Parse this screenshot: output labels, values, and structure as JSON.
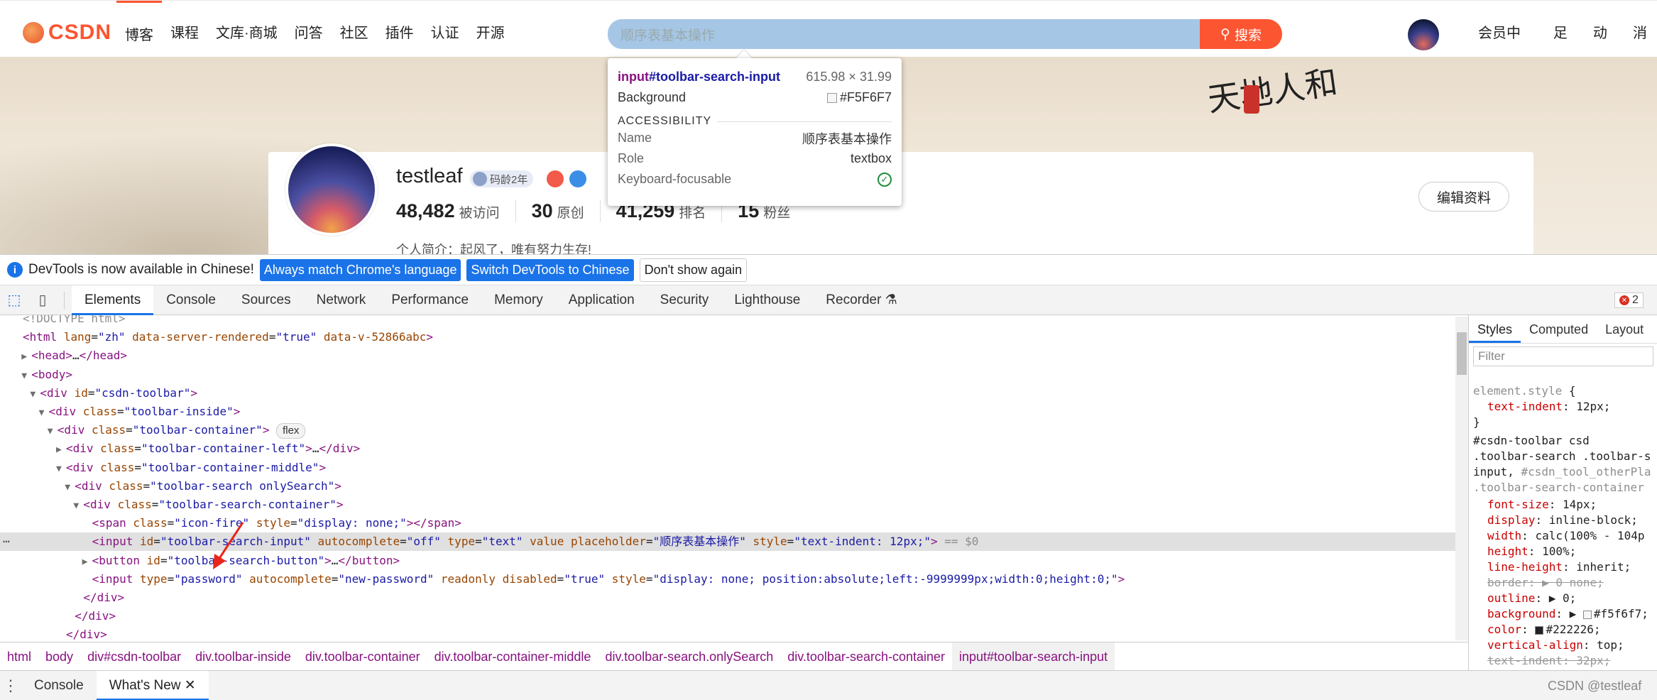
{
  "site": {
    "logo_text": "CSDN",
    "nav": [
      "博客",
      "课程",
      "文库·商城",
      "问答",
      "社区",
      "插件",
      "认证",
      "开源"
    ],
    "search_placeholder": "顺序表基本操作",
    "search_button": "搜索",
    "right_nav": [
      "会员中心 🎁",
      "足迹",
      "动态",
      "消"
    ],
    "accent": "#fc5531"
  },
  "profile": {
    "username": "testleaf",
    "badge_age": "码龄2年",
    "stats": [
      {
        "value": "48,482",
        "label": "被访问"
      },
      {
        "value": "30",
        "label": "原创"
      },
      {
        "value": "41,259",
        "label": "排名"
      },
      {
        "value": "15",
        "label": "粉丝"
      }
    ],
    "bio": "个人简介：起风了，唯有努力生存!",
    "edit_button": "编辑资料",
    "calligraphy": "天地人和"
  },
  "tooltip": {
    "selector_tag": "input",
    "selector_id": "#toolbar-search-input",
    "size": "615.98 × 31.99",
    "background_label": "Background",
    "background_value": "#F5F6F7",
    "section": "ACCESSIBILITY",
    "name_label": "Name",
    "name_value": "顺序表基本操作",
    "role_label": "Role",
    "role_value": "textbox",
    "focus_label": "Keyboard-focusable"
  },
  "infobar": {
    "message": "DevTools is now available in Chinese!",
    "btn_match": "Always match Chrome's language",
    "btn_switch": "Switch DevTools to Chinese",
    "btn_dismiss": "Don't show again"
  },
  "devtools_tabs": [
    "Elements",
    "Console",
    "Sources",
    "Network",
    "Performance",
    "Memory",
    "Application",
    "Security",
    "Lighthouse",
    "Recorder ⚗"
  ],
  "error_count": "2",
  "dom_lines": [
    {
      "indent": 0,
      "tri": "",
      "html": "<span class=\"cm\">&lt;!DOCTYPE html&gt;</span>"
    },
    {
      "indent": 0,
      "tri": "",
      "html": "<span class=\"tg\">&lt;html</span> <span class=\"an\">lang</span>=<span class=\"av\">\"zh\"</span> <span class=\"an\">data-server-rendered</span>=<span class=\"av\">\"true\"</span> <span class=\"an\">data-v-52866abc</span><span class=\"tg\">&gt;</span>"
    },
    {
      "indent": 1,
      "tri": "▶",
      "html": "<span class=\"tg\">&lt;head&gt;</span>…<span class=\"tg\">&lt;/head&gt;</span>"
    },
    {
      "indent": 1,
      "tri": "▼",
      "html": "<span class=\"tg\">&lt;body&gt;</span>"
    },
    {
      "indent": 2,
      "tri": "▼",
      "html": "<span class=\"tg\">&lt;div</span> <span class=\"an\">id</span>=<span class=\"av\">\"csdn-toolbar\"</span><span class=\"tg\">&gt;</span>"
    },
    {
      "indent": 3,
      "tri": "▼",
      "html": "<span class=\"tg\">&lt;div</span> <span class=\"an\">class</span>=<span class=\"av\">\"toolbar-inside\"</span><span class=\"tg\">&gt;</span>"
    },
    {
      "indent": 4,
      "tri": "▼",
      "html": "<span class=\"tg\">&lt;div</span> <span class=\"an\">class</span>=<span class=\"av\">\"toolbar-container\"</span><span class=\"tg\">&gt;</span> <span class=\"pill\">flex</span>"
    },
    {
      "indent": 5,
      "tri": "▶",
      "html": "<span class=\"tg\">&lt;div</span> <span class=\"an\">class</span>=<span class=\"av\">\"toolbar-container-left\"</span><span class=\"tg\">&gt;</span>…<span class=\"tg\">&lt;/div&gt;</span>"
    },
    {
      "indent": 5,
      "tri": "▼",
      "html": "<span class=\"tg\">&lt;div</span> <span class=\"an\">class</span>=<span class=\"av\">\"toolbar-container-middle\"</span><span class=\"tg\">&gt;</span>"
    },
    {
      "indent": 6,
      "tri": "▼",
      "html": "<span class=\"tg\">&lt;div</span> <span class=\"an\">class</span>=<span class=\"av\">\"toolbar-search onlySearch\"</span><span class=\"tg\">&gt;</span>"
    },
    {
      "indent": 7,
      "tri": "▼",
      "html": "<span class=\"tg\">&lt;div</span> <span class=\"an\">class</span>=<span class=\"av\">\"toolbar-search-container\"</span><span class=\"tg\">&gt;</span>"
    },
    {
      "indent": 8,
      "tri": "",
      "html": "<span class=\"tg\">&lt;span</span> <span class=\"an\">class</span>=<span class=\"av\">\"icon-fire\"</span> <span class=\"an\">style</span>=<span class=\"av\">\"display: none;\"</span><span class=\"tg\">&gt;&lt;/span&gt;</span>"
    },
    {
      "indent": 8,
      "tri": "",
      "hl": true,
      "html": "<span class=\"tg\">&lt;input</span> <span class=\"an\">id</span>=<span class=\"av\">\"toolbar-search-input\"</span> <span class=\"an\">autocomplete</span>=<span class=\"av\">\"off\"</span> <span class=\"an\">type</span>=<span class=\"av\">\"text\"</span> <span class=\"an\">value</span> <span class=\"an\">placeholder</span>=<span class=\"av\">\"顺序表基本操作\"</span> <span class=\"an\">style</span>=<span class=\"av\">\"text-indent: 12px;\"</span><span class=\"tg\">&gt;</span> <span class=\"cm\">== $0</span>"
    },
    {
      "indent": 8,
      "tri": "▶",
      "html": "<span class=\"tg\">&lt;button</span> <span class=\"an\">id</span>=<span class=\"av\">\"toolbar-search-button\"</span><span class=\"tg\">&gt;</span>…<span class=\"tg\">&lt;/button&gt;</span>"
    },
    {
      "indent": 8,
      "tri": "",
      "html": "<span class=\"tg\">&lt;input</span> <span class=\"an\">type</span>=<span class=\"av\">\"password\"</span> <span class=\"an\">autocomplete</span>=<span class=\"av\">\"new-password\"</span> <span class=\"an\">readonly</span> <span class=\"an\">disabled</span>=<span class=\"av\">\"true\"</span> <span class=\"an\">style</span>=<span class=\"av\">\"display: none; position:absolute;left:-9999999px;width:0;height:0;\"</span><span class=\"tg\">&gt;</span>"
    },
    {
      "indent": 7,
      "tri": "",
      "html": "<span class=\"tg\">&lt;/div&gt;</span>"
    },
    {
      "indent": 6,
      "tri": "",
      "html": "<span class=\"tg\">&lt;/div&gt;</span>"
    },
    {
      "indent": 5,
      "tri": "",
      "html": "<span class=\"tg\">&lt;/div&gt;</span>"
    }
  ],
  "breadcrumbs": [
    "html",
    "body",
    "div#csdn-toolbar",
    "div.toolbar-inside",
    "div.toolbar-container",
    "div.toolbar-container-middle",
    "div.toolbar-search.onlySearch",
    "div.toolbar-search-container",
    "input#toolbar-search-input"
  ],
  "styles_tabs": [
    "Styles",
    "Computed",
    "Layout"
  ],
  "styles_filter": "Filter",
  "style_lines": [
    {
      "cls": "sl",
      "html": "<span class=\"cm\">element.style</span> {"
    },
    {
      "cls": "sl ind",
      "html": "<span class=\"pn\">text-indent</span>: <span class=\"pv\">12px;</span>"
    },
    {
      "cls": "sl",
      "html": "}"
    },
    {
      "cls": "sl",
      "html": "#csdn-toolbar          csd"
    },
    {
      "cls": "sl",
      "html": ".toolbar-search .toolbar-s"
    },
    {
      "cls": "sl",
      "html": "input, <span class=\"cm\">#csdn_tool_otherPla</span>"
    },
    {
      "cls": "sl",
      "html": "<span class=\"cm\">.toolbar-search-container</span>"
    },
    {
      "cls": "sl ind",
      "html": "<span class=\"pn\">font-size</span>: <span class=\"pv\">14px;</span>"
    },
    {
      "cls": "sl ind",
      "html": "<span class=\"pn\">display</span>: <span class=\"pv\">inline-block;</span>"
    },
    {
      "cls": "sl ind",
      "html": "<span class=\"pn\">width</span>: <span class=\"pv\">calc(100% - 104p</span>"
    },
    {
      "cls": "sl ind",
      "html": "<span class=\"pn\">height</span>: <span class=\"pv\">100%;</span>"
    },
    {
      "cls": "sl ind",
      "html": "<span class=\"pn\">line-height</span>: <span class=\"pv\">inherit;</span>"
    },
    {
      "cls": "sl ind",
      "html": "<span class=\"strike\">border: ▶ 0 none;</span>"
    },
    {
      "cls": "sl ind",
      "html": "<span class=\"pn\">outline</span>: <span class=\"pv\">▶ 0;</span>"
    },
    {
      "cls": "sl ind",
      "html": "<span class=\"pn\">background</span>: <span class=\"pv\">▶ <span class=\"sw\" style=\"background:#f5f6f7\"></span>#f5f6f7;</span>"
    },
    {
      "cls": "sl ind",
      "html": "<span class=\"pn\">color</span>: <span class=\"pv\"><span class=\"sw\" style=\"background:#222226\"></span>#222226;</span>"
    },
    {
      "cls": "sl ind",
      "html": "<span class=\"pn\">vertical-align</span>: <span class=\"pv\">top;</span>"
    },
    {
      "cls": "sl ind",
      "html": "<span class=\"strike\">text-indent: 32px;</span>"
    }
  ],
  "drawer_tabs": [
    "Console",
    "What's New ✕"
  ],
  "watermark": "CSDN @testleaf"
}
